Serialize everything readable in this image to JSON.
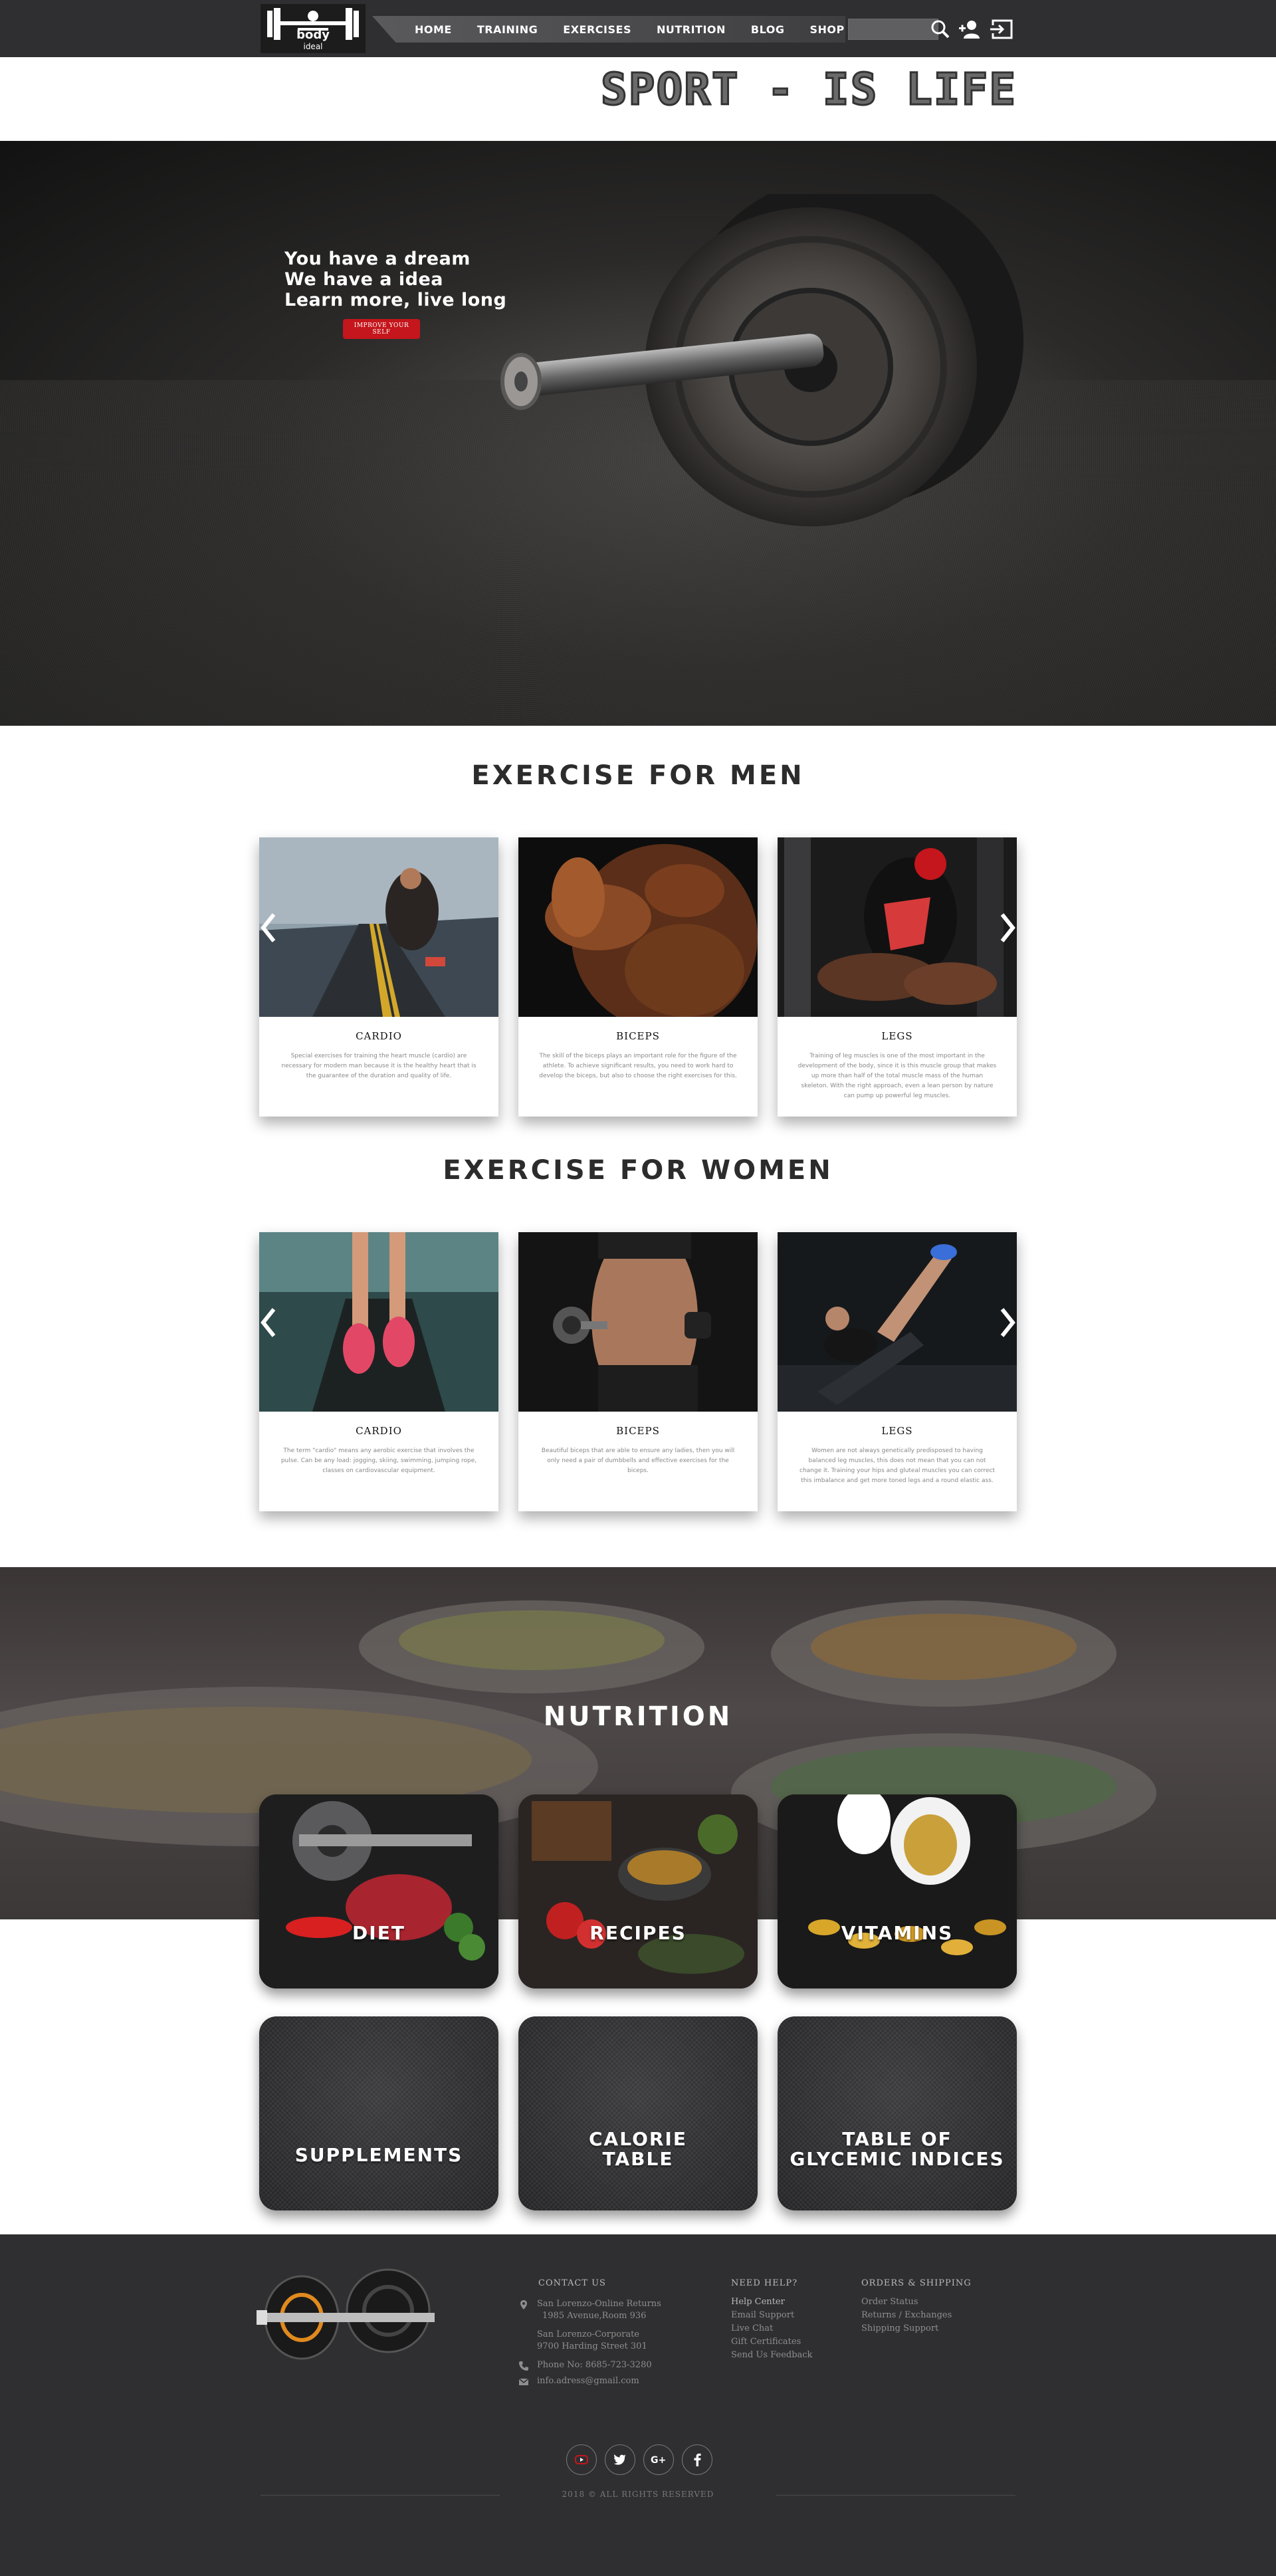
{
  "header": {
    "logo_word_top": "body",
    "logo_word_bottom": "ideal",
    "nav": [
      "HOME",
      "TRAINING",
      "EXERCISES",
      "NUTRITION",
      "BLOG",
      "SHOP"
    ],
    "search_placeholder": "",
    "site_title": "SPORT - IS LIFE"
  },
  "hero": {
    "lines": [
      "You have a dream",
      "We have a idea",
      "Learn more, live long"
    ],
    "button_label": "IMPROVE YOUR SELF"
  },
  "men": {
    "title": "EXERCISE FOR MEN",
    "cards": [
      {
        "title": "CARDIO",
        "text": "Special exercises for training the heart muscle (cardio) are necessary for modern man because it is the healthy heart that is the guarantee of the duration and quality of life."
      },
      {
        "title": "BICEPS",
        "text": "The skill of the biceps plays an important role for the figure of the athlete. To achieve significant results, you need to work hard to develop the biceps, but also to choose the right exercises for this."
      },
      {
        "title": "LEGS",
        "text": "Training of leg muscles is one of the most important in the development of the body, since it is this muscle group that makes up more than half of the total muscle mass of the human skeleton. With the right approach, even a lean person by nature can pump up powerful leg muscles."
      }
    ]
  },
  "women": {
    "title": "EXERCISE FOR WOMEN",
    "cards": [
      {
        "title": "CARDIO",
        "text": "The term \"cardio\" means any aerobic exercise that involves the pulse. Can be any load: jogging, skiing, swimming, jumping rope, classes on cardiovascular equipment."
      },
      {
        "title": "BICEPS",
        "text": "Beautiful biceps that are able to ensure any ladies, then you will only need a pair of dumbbells and effective exercises for the biceps."
      },
      {
        "title": "LEGS",
        "text": "Women are not always genetically predisposed to having balanced leg muscles, this does not mean that you can not change it. Training your hips and gluteal muscles you can correct this imbalance and get more toned legs and a round elastic ass."
      }
    ]
  },
  "nutrition": {
    "title": "NUTRITION",
    "tiles": [
      {
        "label": "DIET"
      },
      {
        "label": "RECIPES"
      },
      {
        "label": "VITAMINS"
      },
      {
        "label": "SUPPLEMENTS"
      },
      {
        "label_1": "CALORIE",
        "label_2": "TABLE"
      },
      {
        "label_1": "TABLE OF",
        "label_2": "GLYCEMIC INDICES"
      }
    ]
  },
  "footer": {
    "contact_title": "CONTACT US",
    "address_1_line_1": "San Lorenzo-Online Returns",
    "address_1_line_2": "1985 Avenue,Room 936",
    "address_2_line_1": "San Lorenzo-Corporate",
    "address_2_line_2": "9700 Harding Street 301",
    "phone": "Phone No: 8685-723-3280",
    "email": "info.adress@gmail.com",
    "help_title": "NEED HELP?",
    "help_links": [
      "Help Center",
      "Email Support",
      "Live Chat",
      "Gift Certificates",
      "Send Us Feedback"
    ],
    "orders_title": "ORDERS & SHIPPING",
    "orders_links": [
      "Order Status",
      "Returns / Exchanges",
      "Shipping Support"
    ],
    "copyright": "2018 ©   ALL RIGHTS RESERVED"
  },
  "colors": {
    "topbar": "#2f2f31",
    "accent_red": "#c4161c",
    "social_youtube": "#c4161c",
    "social_twitter": "#3b5998",
    "social_google": "#c4161c",
    "social_facebook": "#3b5998"
  },
  "icons": {
    "search": "search-icon",
    "add_user": "add-user-icon",
    "login": "login-icon",
    "arrows": [
      "chevron-left-icon",
      "chevron-right-icon"
    ],
    "contact": [
      "location-icon",
      "phone-icon",
      "email-icon"
    ],
    "social": [
      "youtube-icon",
      "twitter-icon",
      "google-plus-icon",
      "facebook-icon"
    ]
  }
}
